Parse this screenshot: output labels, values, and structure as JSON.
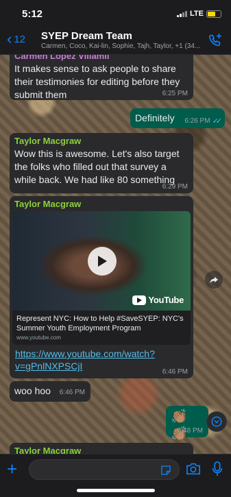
{
  "status": {
    "time": "5:12",
    "network": "LTE"
  },
  "header": {
    "back_count": "12",
    "title": "SYEP Dream Team",
    "members": "Carmen, Coco, Kai-lin, Sophie, Tajh, Taylor, +1 (34..."
  },
  "messages": [
    {
      "sender": "Carmen Lopez Villamil",
      "sender_color": "#c880d8",
      "text": "It makes sense to ask people to share their testimonies for editing before they submit them",
      "time": "6:25 PM"
    },
    {
      "text": "Definitely",
      "time": "6:26 PM",
      "outgoing": true
    },
    {
      "sender": "Taylor Macgraw",
      "sender_color": "#8bd23c",
      "text": "Wow this is awesome. Let's also target the folks who filled out that survey a while back. We had like 80 something",
      "time": "6:29 PM"
    },
    {
      "sender": "Taylor Macgraw",
      "sender_color": "#8bd23c",
      "preview_title": "Represent NYC: How to Help #SaveSYEP: NYC's Summer Youth Employment Program",
      "preview_domain": "www.youtube.com",
      "preview_brand": "YouTube",
      "link": "https://www.youtube.com/watch?v=gPnlNXPSCjI",
      "time": "6:46 PM"
    },
    {
      "text": "woo hoo",
      "time": "6:46 PM"
    },
    {
      "text": "👏🏽👏🏽",
      "time": "6:48 PM",
      "outgoing": true
    },
    {
      "sender": "Taylor Macgraw",
      "sender_color": "#8bd23c"
    }
  ],
  "icons": {
    "back": "chevron-left-icon",
    "add_call": "phone-plus-icon",
    "play": "play-icon",
    "forward": "forward-icon",
    "scroll_down": "chevron-down-icon",
    "attach": "plus-icon",
    "sticker": "sticker-icon",
    "camera": "camera-icon",
    "mic": "microphone-icon"
  },
  "colors": {
    "accent": "#0a84ff",
    "outgoing_bubble": "#005c4b",
    "incoming_bubble": "#2a2a2c",
    "link": "#53bdeb"
  }
}
